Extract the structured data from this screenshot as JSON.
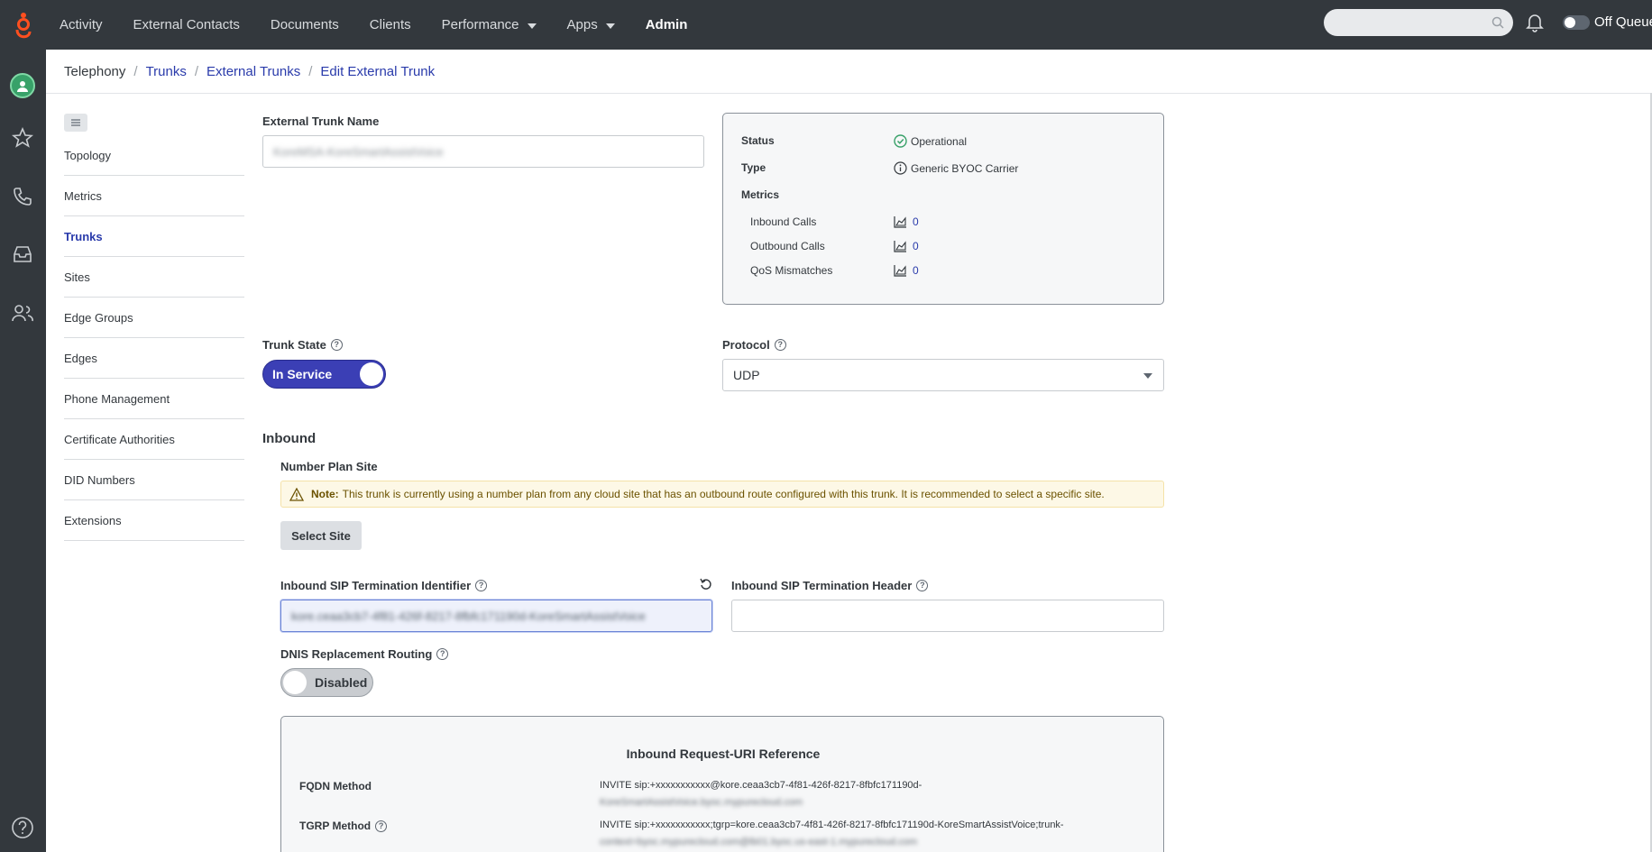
{
  "colors": {
    "topbar": "#33383d",
    "accent": "#2a3bab",
    "toggle_on": "#3b3fb5",
    "success": "#38a169",
    "note_bg": "#fdf8e6"
  },
  "topbar": {
    "logo_icon": "genesys-logo-icon",
    "nav": [
      {
        "label": "Activity",
        "has_caret": false
      },
      {
        "label": "External Contacts",
        "has_caret": false
      },
      {
        "label": "Documents",
        "has_caret": false
      },
      {
        "label": "Clients",
        "has_caret": false
      },
      {
        "label": "Performance",
        "has_caret": true
      },
      {
        "label": "Apps",
        "has_caret": true
      },
      {
        "label": "Admin",
        "has_caret": false
      }
    ],
    "search_placeholder": "",
    "queue_label": "Off Queue"
  },
  "rail": {
    "icons": [
      "avatar-icon",
      "star-icon",
      "phone-icon",
      "inbox-icon",
      "users-icon",
      "help-icon"
    ]
  },
  "breadcrumb": {
    "items": [
      "Telephony",
      "Trunks",
      "External Trunks",
      "Edit External Trunk"
    ]
  },
  "subnav": {
    "items": [
      "Topology",
      "Metrics",
      "Trunks",
      "Sites",
      "Edge Groups",
      "Edges",
      "Phone Management",
      "Certificate Authorities",
      "DID Numbers",
      "Extensions"
    ],
    "active": "Trunks"
  },
  "form": {
    "trunk_name_label": "External Trunk Name",
    "trunk_name_value": "KoreMSA-KoreSmartAssistVoice",
    "trunk_state_label": "Trunk State",
    "trunk_state_value": "In Service",
    "protocol_label": "Protocol",
    "protocol_value": "UDP",
    "inbound_heading": "Inbound",
    "number_plan_label": "Number Plan Site",
    "note_prefix": "Note:",
    "note_text": "This trunk is currently using a number plan from any cloud site that has an outbound route configured with this trunk. It is recommended to select a specific site.",
    "select_site_label": "Select Site",
    "sip_term_id_label": "Inbound SIP Termination Identifier",
    "sip_term_id_value": "kore.ceaa3cb7-4f81-426f-8217-8fbfc171190d-KoreSmartAssistVoice",
    "sip_term_header_label": "Inbound SIP Termination Header",
    "sip_term_header_value": "",
    "dnis_label": "DNIS Replacement Routing",
    "dnis_value": "Disabled"
  },
  "status_card": {
    "status_label": "Status",
    "status_value": "Operational",
    "type_label": "Type",
    "type_value": "Generic BYOC Carrier",
    "metrics_label": "Metrics",
    "metrics": [
      {
        "label": "Inbound Calls",
        "value": "0"
      },
      {
        "label": "Outbound Calls",
        "value": "0"
      },
      {
        "label": "QoS Mismatches",
        "value": "0"
      }
    ]
  },
  "ref_card": {
    "title": "Inbound Request-URI Reference",
    "fqdn_label": "FQDN Method",
    "fqdn_line1": "INVITE sip:+xxxxxxxxxxx@kore.ceaa3cb7-4f81-426f-8217-8fbfc171190d-",
    "fqdn_line2": "KoreSmartAssistVoice.byoc.mypurecloud.com",
    "tgrp_label": "TGRP Method",
    "tgrp_line1": "INVITE sip:+xxxxxxxxxxx;tgrp=kore.ceaa3cb7-4f81-426f-8217-8fbfc171190d-KoreSmartAssistVoice;trunk-",
    "tgrp_line2": "context=byoc.mypurecloud.com@lb01.byoc.us-east-1.mypurecloud.com"
  }
}
